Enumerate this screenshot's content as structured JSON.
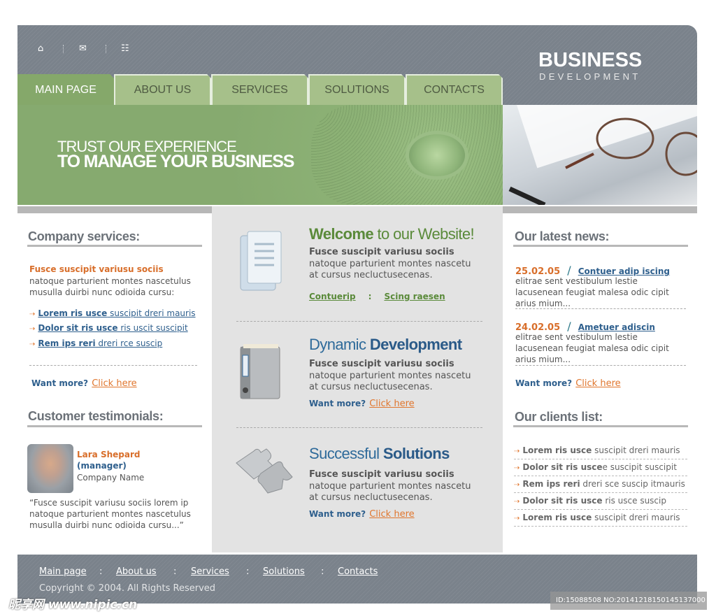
{
  "header": {
    "icons": [
      "home-icon",
      "mail-icon",
      "sitemap-icon"
    ],
    "logo_line1": "BUSINESS",
    "logo_line2": "DEVELOPMENT"
  },
  "tabs": [
    {
      "label": "MAIN PAGE",
      "active": true
    },
    {
      "label": "ABOUT US"
    },
    {
      "label": "SERVICES"
    },
    {
      "label": "SOLUTIONS"
    },
    {
      "label": "CONTACTS"
    }
  ],
  "banner": {
    "line1": "TRUST OUR EXPERIENCE",
    "line2": "TO MANAGE YOUR BUSINESS"
  },
  "left": {
    "services_title": "Company services:",
    "services_lead": "Fusce suscipit variusu sociis",
    "services_text": "natoque parturient montes nascetulus musulla duirbi nunc odioida cursu:",
    "links": [
      {
        "bold": "Lorem ris usce",
        "rest": " suscipit dreri mauris"
      },
      {
        "bold": "Dolor sit ris usce",
        "rest": " ris uscit suscipit"
      },
      {
        "bold": "Rem ips reri",
        "rest": " dreri rce suscip"
      }
    ],
    "want_more": "Want more?",
    "click_here": "Click here",
    "testimonials_title": "Customer testimonials:",
    "person_name": "Lara Shepard",
    "person_role": "(manager)",
    "company": "Company Name",
    "quote": "“Fusce suscipit variusu sociis lorem ip natoque parturient montes nascetulus musulla duirbi nunc odioida cursu...”"
  },
  "center": {
    "blocks": [
      {
        "icon": "document-box-icon",
        "title_a": "Welcome",
        "title_b": " to our Website!",
        "lead": "Fusce suscipit variusu sociis",
        "text": "natoque parturient montes nascetu at cursus necluctusecenas.",
        "link1": "Contuerip",
        "sep": ":",
        "link2": "Scing raesen"
      },
      {
        "icon": "binder-icon",
        "title_a": "Dynamic ",
        "title_b": "Development",
        "lead": "Fusce suscipit variusu sociis",
        "text": "natoque parturient montes nascetu at cursus necluctusecenas.",
        "want_more": "Want more?",
        "click_here": "Click here"
      },
      {
        "icon": "puzzle-icon",
        "title_a": "Successful ",
        "title_b": "Solutions",
        "lead": "Fusce suscipit variusu sociis",
        "text": "natoque parturient montes nascetu at cursus necluctusecenas.",
        "want_more": "Want more?",
        "click_here": "Click here"
      }
    ]
  },
  "right": {
    "news_title": "Our latest news:",
    "news": [
      {
        "date": "25.02.05",
        "sep": "/",
        "title": "Contuer adip iscing",
        "text": "elitrae sent vestibulum lestie lacusenean feugiat malesa odic cipit arius mium..."
      },
      {
        "date": "24.02.05",
        "sep": "/",
        "title": "Ametuer adiscin",
        "text": "elitrae sent vestibulum lestie lacusenean feugiat malesa odic cipit arius mium..."
      }
    ],
    "want_more": "Want more?",
    "click_here": "Click here",
    "clients_title": "Our clients list:",
    "clients": [
      {
        "bold": "Lorem ris usce",
        "rest": " suscipit dreri mauris"
      },
      {
        "bold": "Dolor sit ris usce",
        "rest": "e suscipit suscipit"
      },
      {
        "bold": "Rem ips reri",
        "rest": " dreri sce suscip itmauris"
      },
      {
        "bold": "Dolor sit ris usce",
        "rest": " ris usce suscip"
      },
      {
        "bold": "Lorem ris usce",
        "rest": " suscipit dreri mauris"
      }
    ]
  },
  "footer": {
    "links": [
      "Main page",
      "About us",
      "Services",
      "Solutions",
      "Contacts"
    ],
    "sep": ":",
    "copyright": "Copyright © 2004. All Rights Reserved"
  },
  "watermark": {
    "site": "昵享网 www.nipic.cn",
    "id": "ID:15088508 NO:20141218150145137000"
  },
  "colors": {
    "header_gray": "#7a828b",
    "tab_green": "#a6c08a",
    "active_green": "#85a86a",
    "orange": "#d86e2a",
    "blue": "#2e5f8d",
    "green_title": "#5a8a3a"
  }
}
